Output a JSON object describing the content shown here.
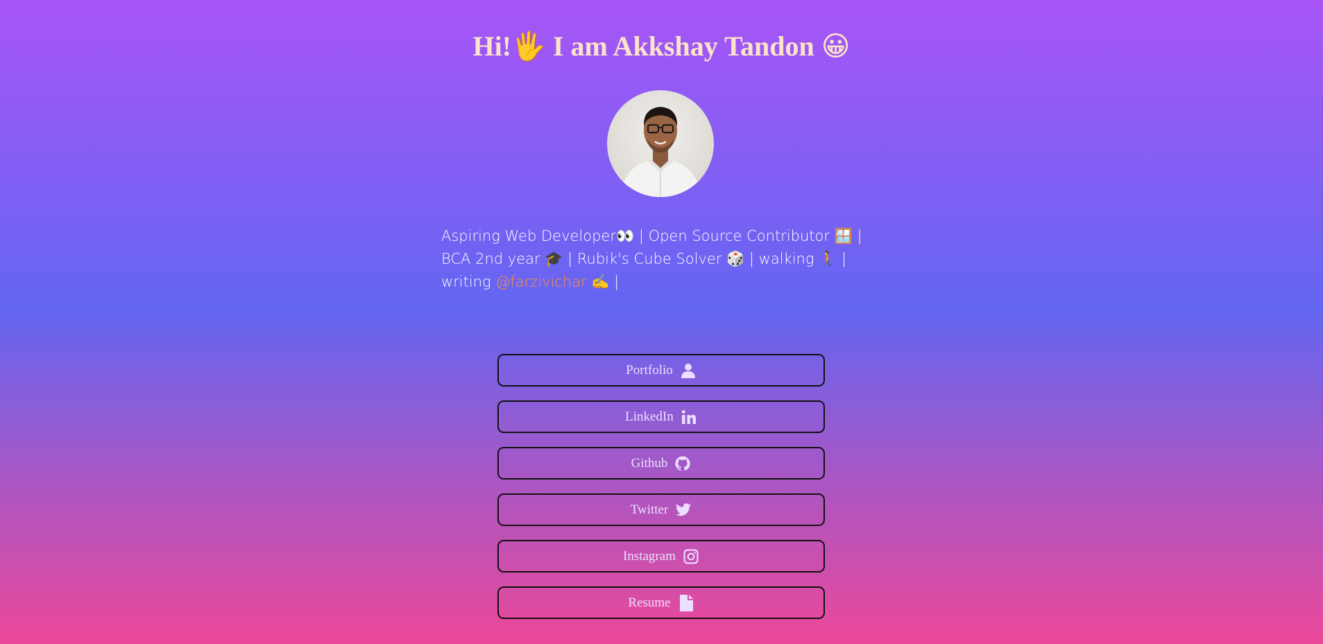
{
  "header": {
    "title_prefix": "Hi!",
    "wave_emoji": "🖐",
    "title_name": " I am Akkshay Tandon ",
    "smile_emoji": "😀"
  },
  "avatar": {
    "alt": "Akkshay Tandon profile photo"
  },
  "bio": {
    "line1": "Aspiring Web Developer👀 | Open Source Contributor 🪟 |",
    "line2": "BCA 2nd year 🎓 | Rubik's Cube Solver 🎲 | walking 🚶 |",
    "line3_prefix": "writing ",
    "handle": "@farzivichar",
    "line3_suffix": " ✍️ |"
  },
  "links": [
    {
      "label": "Portfolio",
      "icon": "user-icon"
    },
    {
      "label": "LinkedIn",
      "icon": "linkedin-icon"
    },
    {
      "label": "Github",
      "icon": "github-icon"
    },
    {
      "label": "Twitter",
      "icon": "twitter-icon"
    },
    {
      "label": "Instagram",
      "icon": "instagram-icon"
    },
    {
      "label": "Resume",
      "icon": "file-icon"
    }
  ],
  "colors": {
    "gradient_top": "#a855f7",
    "gradient_mid": "#6366f1",
    "gradient_bottom": "#ec4899",
    "title": "#fde4c8",
    "handle": "#fb923c",
    "button_border": "#111111"
  }
}
